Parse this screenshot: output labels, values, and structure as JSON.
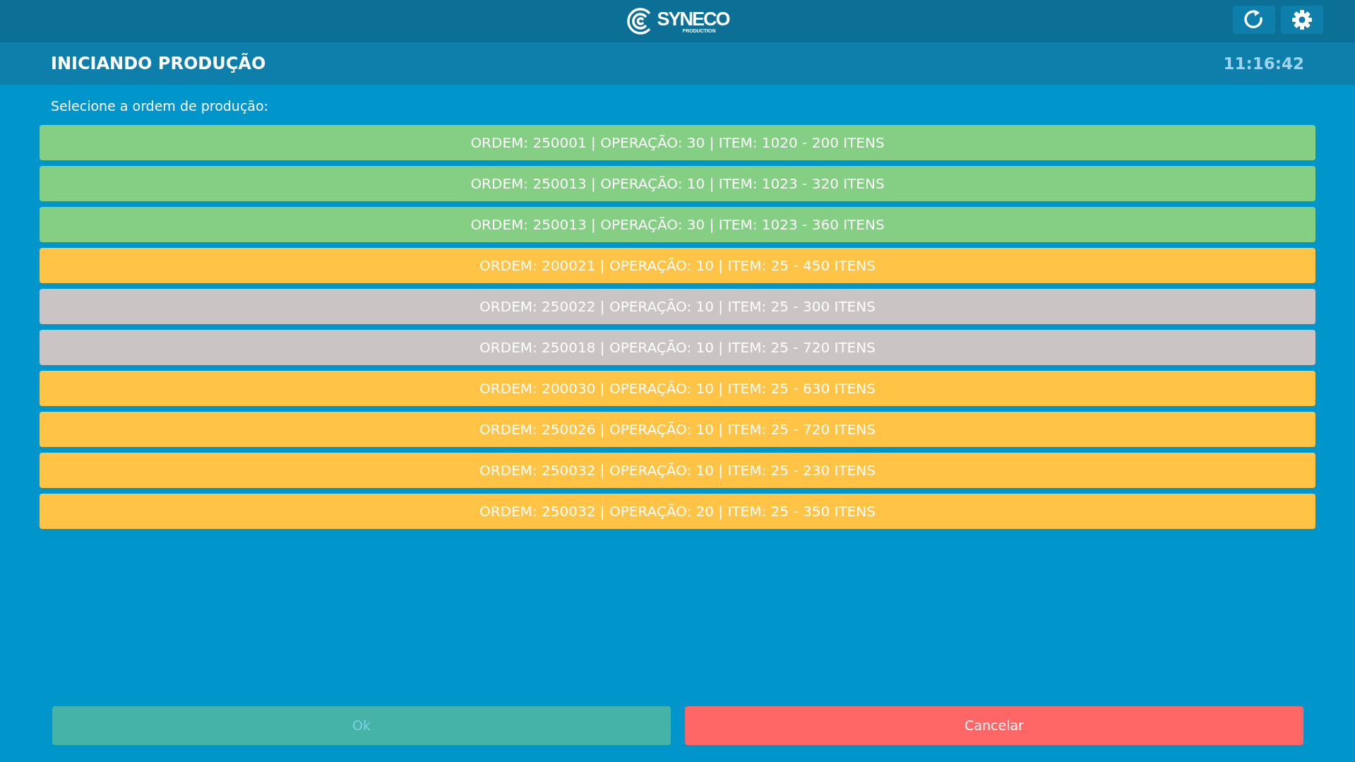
{
  "header": {
    "logo_name": "SYNECO",
    "logo_sub": "PRODUCTION"
  },
  "title_bar": {
    "title": "INICIANDO PRODUÇÃO",
    "time": "11:16:42"
  },
  "prompt": "Selecione a ordem de produção:",
  "orders": [
    {
      "label": "ORDEM: 250001 | OPERAÇÃO: 30 | ITEM: 1020 - 200 ITENS",
      "color": "#85cf85"
    },
    {
      "label": "ORDEM: 250013 | OPERAÇÃO: 10 | ITEM: 1023 - 320 ITENS",
      "color": "#85cf85"
    },
    {
      "label": "ORDEM: 250013 | OPERAÇÃO: 30 | ITEM: 1023 - 360 ITENS",
      "color": "#85cf85"
    },
    {
      "label": "ORDEM: 200021 | OPERAÇÃO: 10 | ITEM: 25 - 450 ITENS",
      "color": "#ffc445"
    },
    {
      "label": "ORDEM: 250022 | OPERAÇÃO: 10 | ITEM: 25 - 300 ITENS",
      "color": "#cac4c4"
    },
    {
      "label": "ORDEM: 250018 | OPERAÇÃO: 10 | ITEM: 25 - 720 ITENS",
      "color": "#cac4c4"
    },
    {
      "label": "ORDEM: 200030 | OPERAÇÃO: 10 | ITEM: 25 - 630 ITENS",
      "color": "#ffc445"
    },
    {
      "label": "ORDEM: 250026 | OPERAÇÃO: 10 | ITEM: 25 - 720 ITENS",
      "color": "#ffc445"
    },
    {
      "label": "ORDEM: 250032 | OPERAÇÃO: 10 | ITEM: 25 - 230 ITENS",
      "color": "#ffc445"
    },
    {
      "label": "ORDEM: 250032 | OPERAÇÃO: 20 | ITEM: 25 - 350 ITENS",
      "color": "#ffc445"
    }
  ],
  "buttons": [
    {
      "label": "Ok",
      "kind": "ok",
      "disabled": true
    },
    {
      "label": "Cancelar",
      "kind": "cancel",
      "disabled": false
    }
  ]
}
